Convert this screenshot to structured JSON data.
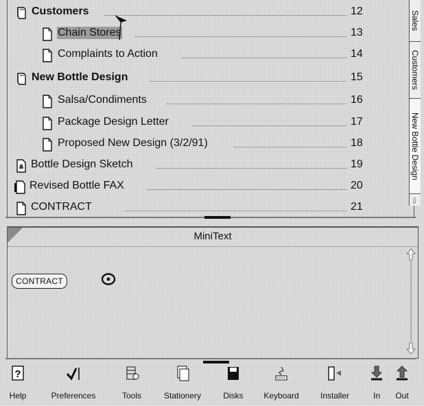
{
  "notebook": {
    "entries": [
      {
        "title": "Customers",
        "page": "12",
        "bold": true,
        "indent": 0,
        "icon": "notebook-section-icon",
        "selected": false
      },
      {
        "title": "Chain Stores",
        "page": "13",
        "bold": false,
        "indent": 1,
        "icon": "page-icon",
        "selected": true
      },
      {
        "title": "Complaints to Action",
        "page": "14",
        "bold": false,
        "indent": 1,
        "icon": "page-icon",
        "selected": false
      },
      {
        "title": "New Bottle Design",
        "page": "15",
        "bold": true,
        "indent": 0,
        "icon": "notebook-section-icon",
        "selected": false
      },
      {
        "title": "Salsa/Condiments",
        "page": "16",
        "bold": false,
        "indent": 1,
        "icon": "page-icon",
        "selected": false
      },
      {
        "title": "Package Design Letter",
        "page": "17",
        "bold": false,
        "indent": 1,
        "icon": "page-icon",
        "selected": false
      },
      {
        "title": "Proposed New Design (3/2/91)",
        "page": "18",
        "bold": false,
        "indent": 1,
        "icon": "page-icon",
        "selected": false
      },
      {
        "title": "Bottle Design Sketch",
        "page": "19",
        "bold": false,
        "indent": 0,
        "icon": "sketch-page-icon",
        "selected": false
      },
      {
        "title": "Revised Bottle FAX",
        "page": "20",
        "bold": false,
        "indent": 0,
        "icon": "fax-page-icon",
        "selected": false
      },
      {
        "title": "CONTRACT",
        "page": "21",
        "bold": false,
        "indent": 0,
        "icon": "page-icon",
        "selected": false
      }
    ],
    "tabs": [
      "Sales",
      "Customers",
      "New Bottle Design"
    ]
  },
  "minitext": {
    "title": "MiniText",
    "tag_label": "CONTRACT"
  },
  "toolbar": {
    "items": [
      {
        "label": "Help",
        "icon": "help-icon"
      },
      {
        "label": "Preferences",
        "icon": "check-preferences-icon"
      },
      {
        "label": "Tools",
        "icon": "tools-icon"
      },
      {
        "label": "Stationery",
        "icon": "stationery-icon"
      },
      {
        "label": "Disks",
        "icon": "disk-icon"
      },
      {
        "label": "Keyboard",
        "icon": "keyboard-icon"
      },
      {
        "label": "Installer",
        "icon": "installer-icon"
      },
      {
        "label": "In",
        "icon": "in-arrow-icon"
      },
      {
        "label": "Out",
        "icon": "out-arrow-icon"
      }
    ]
  }
}
